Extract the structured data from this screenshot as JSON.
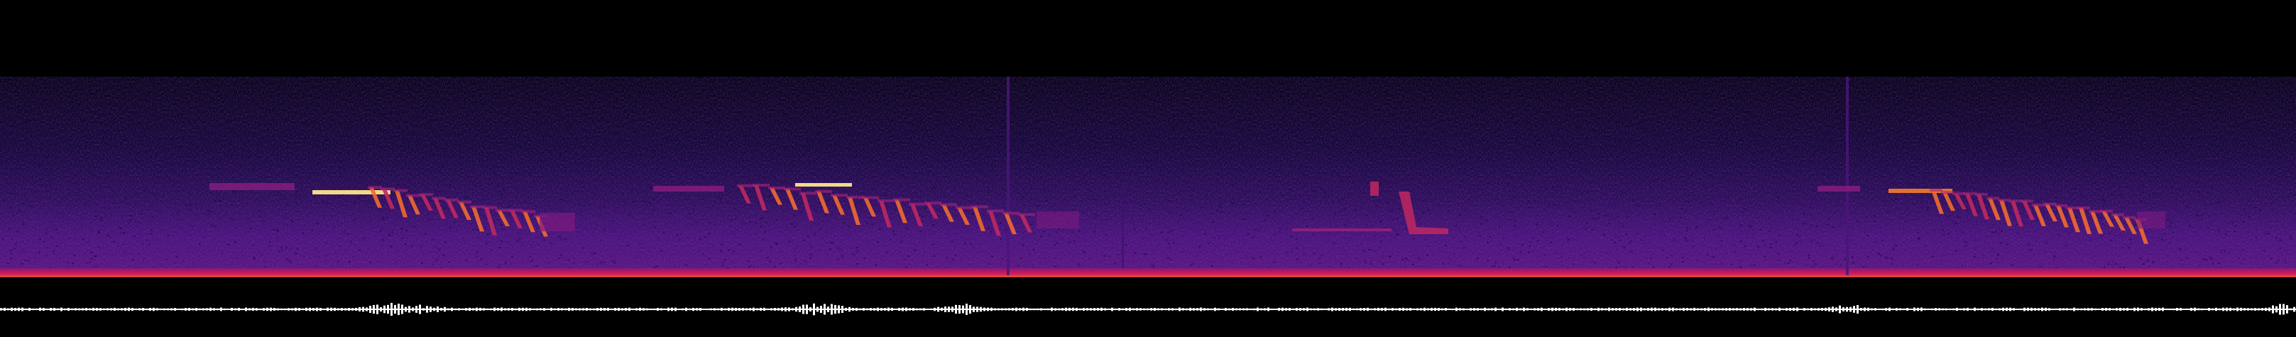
{
  "image": {
    "kind": "spectrogram-with-waveform",
    "background_color": "#000000",
    "colormap": [
      "#000000",
      "#0c0520",
      "#1b0a3e",
      "#35105f",
      "#56127a",
      "#7d1a80",
      "#a8247a",
      "#d0365e",
      "#ee5a35",
      "#fb9a1f",
      "#fde58a"
    ],
    "noise_floor_color": "#3a1369",
    "low_frequency_band_color": "#c0185a",
    "waveform_color": "#ffffff",
    "bird_call_count": 4,
    "click_count": 2
  }
}
